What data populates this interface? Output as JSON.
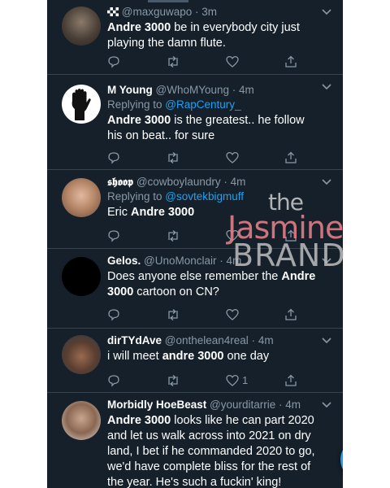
{
  "tweets": [
    {
      "name": "",
      "name_icon": "checkered-flag-icon",
      "handle": "@maxguwapo",
      "time": "· 3m",
      "replying_prefix": "",
      "replying_to": "",
      "text_html": "<b>Andre 3000</b> be in everybody city just playing the damn flute.",
      "likes": ""
    },
    {
      "name": "M Young",
      "handle": "@WhoMYoung",
      "time": "· 4m",
      "replying_prefix": "Replying to ",
      "replying_to": "@RapCentury_",
      "text_html": "<b>Andre 3000</b> is the greatest.. he follow his on beat.. for sure",
      "likes": ""
    },
    {
      "name": "𝖘𝖍𝖔𝖔𝖕",
      "handle": "@cowboylaundry",
      "time": "· 4m",
      "replying_prefix": "Replying to ",
      "replying_to": "@sovtekbigmuff",
      "text_html": "Eric <b>Andre 3000</b>",
      "likes": ""
    },
    {
      "name": "Gelos.",
      "handle": "@UnoMonclair",
      "time": "· 4m",
      "replying_prefix": "",
      "replying_to": "",
      "text_html": "Does anyone else remember the <b>Andre 3000</b> cartoon on CN?",
      "likes": ""
    },
    {
      "name": "dirTYdAve",
      "handle": "@onthelean4real",
      "time": "· 4m",
      "replying_prefix": "",
      "replying_to": "",
      "text_html": "i will meet <b>andre 3000</b> one day",
      "likes": "1"
    },
    {
      "name": "Morbidly HoeBeast",
      "handle": "@yourditarrie",
      "time": "· 4m",
      "replying_prefix": "",
      "replying_to": "",
      "text_html": "<b>Andre 3000</b> looks like he can part 2020 and let us walk across into 2021 on dry land, I bet if he commanded 2020 to go, we'd have complete bliss for the rest of the year. He's such a fuckin' king!",
      "likes": ""
    }
  ],
  "watermark": {
    "line1": "the",
    "line2": "Jasmine",
    "line3": "BRAND"
  },
  "colors": {
    "background": "#15202b",
    "accent": "#1da1f2",
    "muted": "#8899a6",
    "divider": "#38444d"
  },
  "icons": [
    "reply-icon",
    "retweet-icon",
    "like-icon",
    "share-icon",
    "compose-tweet-icon",
    "chevron-down-icon"
  ]
}
